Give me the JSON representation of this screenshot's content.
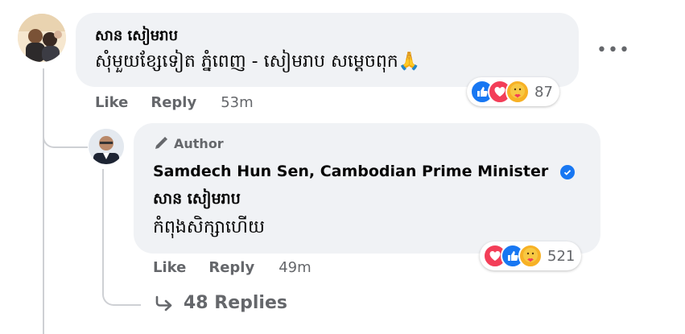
{
  "comment": {
    "author": "សាន សៀមរាប",
    "text": "សុំមួយខ្សែទៀត ភ្នំពេញ - សៀមរាប សម្តេចពុក🙏",
    "like_label": "Like",
    "reply_label": "Reply",
    "time": "53m",
    "reaction_count": "87",
    "more_label": "•••"
  },
  "reply": {
    "badge": "Author",
    "author": "Samdech Hun Sen, Cambodian Prime Minister",
    "mention": "សាន សៀមរាប",
    "text": "កំពុងសិក្សាហើយ",
    "like_label": "Like",
    "reply_label": "Reply",
    "time": "49m",
    "reaction_count": "521"
  },
  "replies_link": {
    "label": "48 Replies"
  },
  "colors": {
    "like_blue": "#1877f2",
    "love_red": "#f33e58",
    "care_yellow": "#f7b125",
    "bubble_bg": "#f0f2f5",
    "meta_gray": "#65676b"
  },
  "icons": [
    "avatar",
    "like-icon",
    "love-icon",
    "care-icon",
    "pencil-icon",
    "verified-badge-icon",
    "reply-arrow-icon",
    "more-icon"
  ]
}
